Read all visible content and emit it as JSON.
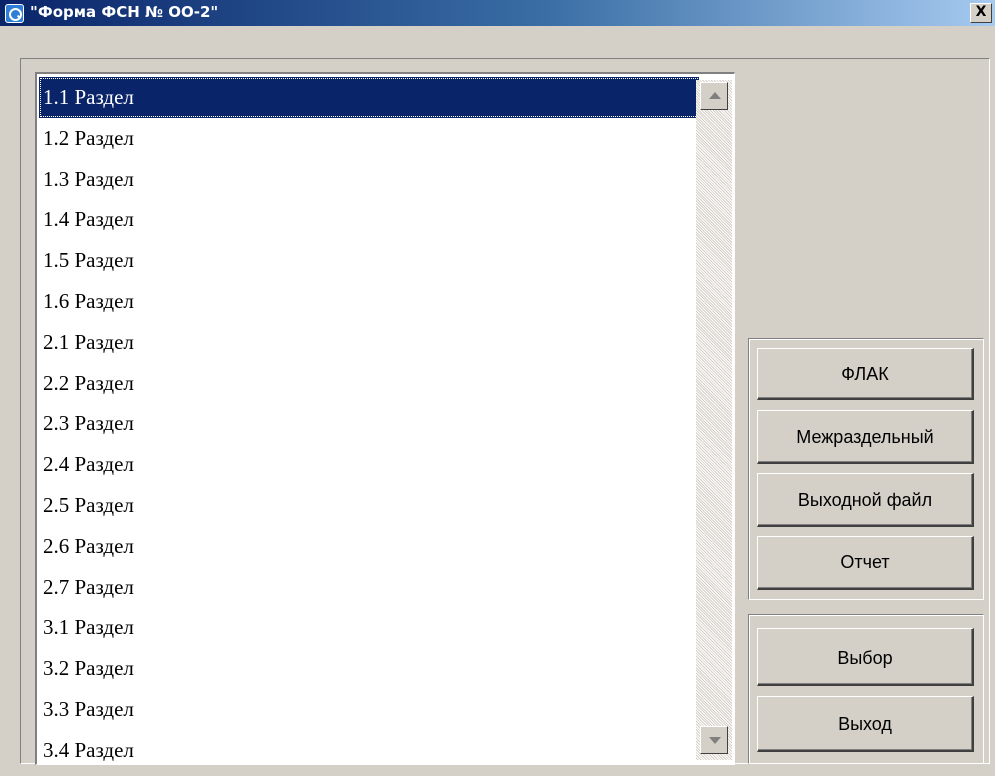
{
  "window": {
    "title": "\"Форма ФСН № ОО-2\"",
    "close_label": "X"
  },
  "sections": {
    "items": [
      {
        "label": "1.1 Раздел",
        "selected": true
      },
      {
        "label": "1.2 Раздел"
      },
      {
        "label": "1.3 Раздел"
      },
      {
        "label": "1.4 Раздел"
      },
      {
        "label": "1.5 Раздел"
      },
      {
        "label": "1.6 Раздел"
      },
      {
        "label": "2.1 Раздел"
      },
      {
        "label": "2.2 Раздел"
      },
      {
        "label": "2.3 Раздел"
      },
      {
        "label": "2.4 Раздел"
      },
      {
        "label": "2.5 Раздел"
      },
      {
        "label": "2.6 Раздел"
      },
      {
        "label": "2.7 Раздел"
      },
      {
        "label": "3.1 Раздел"
      },
      {
        "label": "3.2 Раздел"
      },
      {
        "label": "3.3 Раздел"
      },
      {
        "label": "3.4 Раздел"
      }
    ]
  },
  "actions": {
    "flak_label": "ФЛАК",
    "mezhrazdelny_label": "Межраздельный",
    "output_file_label": "Выходной файл",
    "report_label": "Отчет"
  },
  "dialog": {
    "select_label": "Выбор",
    "exit_label": "Выход"
  },
  "icons": {
    "app": "app-logo-icon",
    "close": "close-icon",
    "scroll_up": "arrow-up-icon",
    "scroll_down": "arrow-down-icon"
  },
  "colors": {
    "titlebar_start": "#0a246a",
    "titlebar_end": "#a6caf0",
    "selection": "#0a246a",
    "face": "#d4d0c8"
  }
}
